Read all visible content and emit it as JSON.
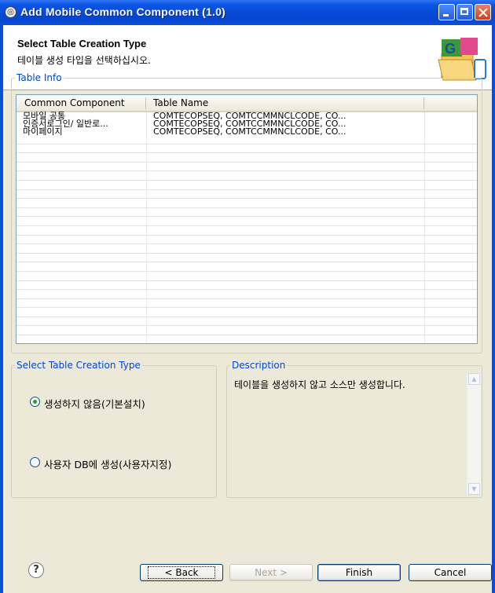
{
  "window": {
    "title": "Add Mobile Common Component (1.0)"
  },
  "header": {
    "title": "Select Table Creation Type",
    "description": "테이블 생성 타입을 선택하십시오."
  },
  "table_info": {
    "group_label": "Table Info",
    "columns": [
      "Common Component",
      "Table Name"
    ],
    "rows": [
      {
        "component": "모바일 공통",
        "tables": "COMTECOPSEQ, COMTCCMMNCLCODE, CO..."
      },
      {
        "component": "인증서로그인/ 일반로...",
        "tables": "COMTECOPSEQ, COMTCCMMNCLCODE, CO..."
      },
      {
        "component": "마이페이지",
        "tables": "COMTECOPSEQ, COMTCCMMNCLCODE, CO..."
      }
    ]
  },
  "creation_type": {
    "group_label": "Select Table Creation Type",
    "options": [
      {
        "label": "생성하지 않음(기본설치)",
        "selected": true
      },
      {
        "label": "사용자 DB에 생성(사용자지정)",
        "selected": false
      }
    ]
  },
  "description": {
    "group_label": "Description",
    "text": "테이블을 생성하지 않고 소스만 생성합니다."
  },
  "buttons": {
    "back": "< Back",
    "next": "Next >",
    "finish": "Finish",
    "cancel": "Cancel",
    "help": "?"
  },
  "colors": {
    "title_bar": "#0a4fd6",
    "dialog_bg": "#ece9d8",
    "group_label": "#0046d5"
  }
}
